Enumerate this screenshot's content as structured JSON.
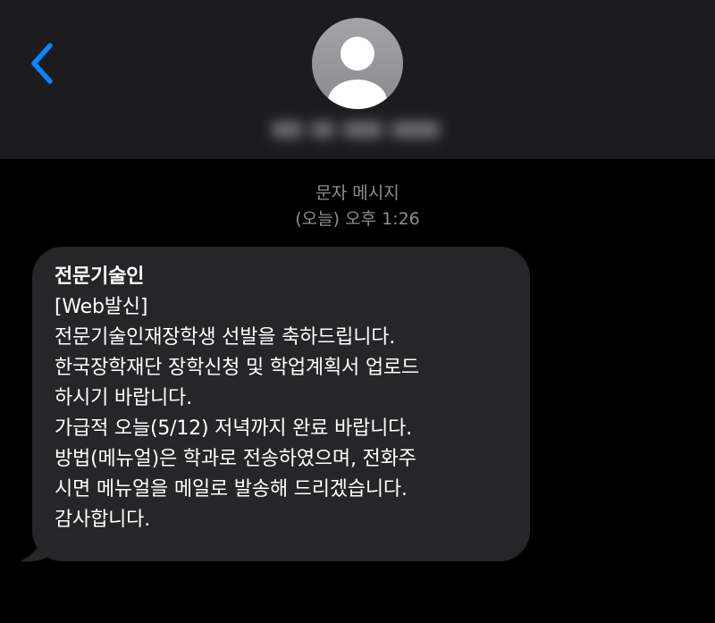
{
  "header": {
    "back_icon": "chevron-left-icon",
    "avatar_icon": "person-silhouette-icon",
    "accent_color": "#0a84ff",
    "contact_name_redacted": true
  },
  "conversation": {
    "message_type": "문자 메시지",
    "timestamp": "(오늘) 오후 1:26"
  },
  "message": {
    "sender": "전문기술인",
    "lines": [
      "[Web발신]",
      "전문기술인재장학생 선발을 축하드립니다.",
      "한국장학재단 장학신청 및 학업계획서 업로드",
      "하시기 바랍니다.",
      "가급적 오늘(5/12) 저녁까지 완료 바랍니다.",
      "방법(메뉴얼)은 학과로 전송하였으며, 전화주",
      "시면 메뉴얼을 메일로 발송해 드리겠습니다.",
      "감사합니다."
    ]
  }
}
